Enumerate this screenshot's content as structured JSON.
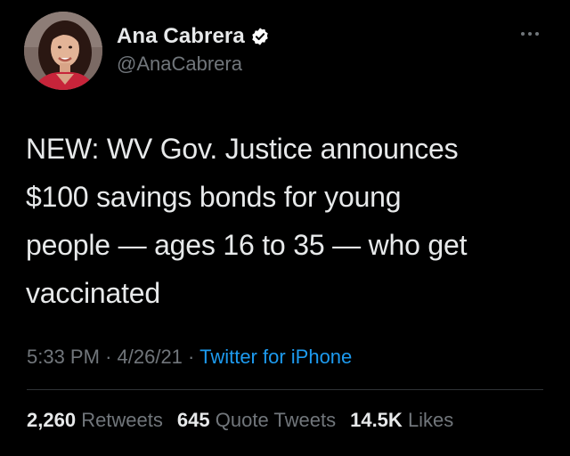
{
  "tweet": {
    "author": {
      "display_name": "Ana Cabrera",
      "handle": "@AnaCabrera",
      "verified": true,
      "avatar_icon": "profile-photo"
    },
    "more_icon": "more-horizontal-icon",
    "text_lines": [
      "NEW: WV Gov. Justice announces",
      "$100 savings bonds for young",
      "people — ages 16 to 35 — who get",
      "vaccinated"
    ],
    "time": "5:33 PM",
    "date": "4/26/21",
    "separator": "·",
    "source": "Twitter for iPhone",
    "stats": {
      "retweets_count": "2,260",
      "retweets_label": "Retweets",
      "quote_count": "645",
      "quote_label": "Quote Tweets",
      "likes_count": "14.5K",
      "likes_label": "Likes"
    }
  },
  "colors": {
    "background": "#000000",
    "text_primary": "#e7e9ea",
    "text_secondary": "#71767b",
    "link": "#1d9bf0",
    "divider": "#2f3336",
    "verified_badge": "#ffffff"
  }
}
